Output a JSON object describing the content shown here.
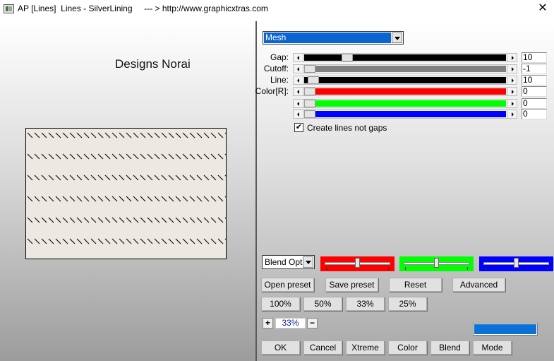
{
  "window": {
    "title": "AP [Lines]  Lines - SilverLining     --- > http://www.graphicxtras.com",
    "close_glyph": "✕"
  },
  "preview": {
    "heading": "Designs Norai"
  },
  "mode_select": {
    "value": "Mesh"
  },
  "sliders": [
    {
      "label": "Gap:",
      "value": "10",
      "thumb_fraction": 0.195,
      "fill": "#000000"
    },
    {
      "label": "Cutoff:",
      "value": "-1",
      "thumb_fraction": 0.0,
      "fill": "#808080"
    },
    {
      "label": "Line:",
      "value": "10",
      "thumb_fraction": 0.02,
      "fill": "#000000"
    },
    {
      "label": "Color[R]:",
      "value": "0",
      "thumb_fraction": 0.0,
      "fill": "#ff0000"
    },
    {
      "label": "",
      "value": "0",
      "thumb_fraction": 0.0,
      "fill": "#00ff00"
    },
    {
      "label": "",
      "value": "0",
      "thumb_fraction": 0.0,
      "fill": "#0000ff"
    }
  ],
  "checkbox": {
    "label": "Create lines not gaps",
    "checked": true,
    "mark": "✔"
  },
  "blend_select": {
    "value": "Blend Options"
  },
  "color_sliders": [
    {
      "color": "#ff0000",
      "fraction": 0.5
    },
    {
      "color": "#00ff00",
      "fraction": 0.5
    },
    {
      "color": "#0000ff",
      "fraction": 0.5
    }
  ],
  "buttons": {
    "open_preset": "Open preset",
    "save_preset": "Save preset",
    "reset": "Reset",
    "advanced": "Advanced",
    "zoom_100": "100%",
    "zoom_50": "50%",
    "zoom_33": "33%",
    "zoom_25": "25%",
    "ok": "OK",
    "cancel": "Cancel",
    "xtreme": "Xtreme",
    "color": "Color",
    "blend": "Blend",
    "mode": "Mode"
  },
  "zoom": {
    "value": "33%",
    "plus": "+",
    "minus": "−"
  },
  "colors": {
    "accent_blue": "#0a72d6",
    "canvas_bg": "#ece9e2"
  }
}
